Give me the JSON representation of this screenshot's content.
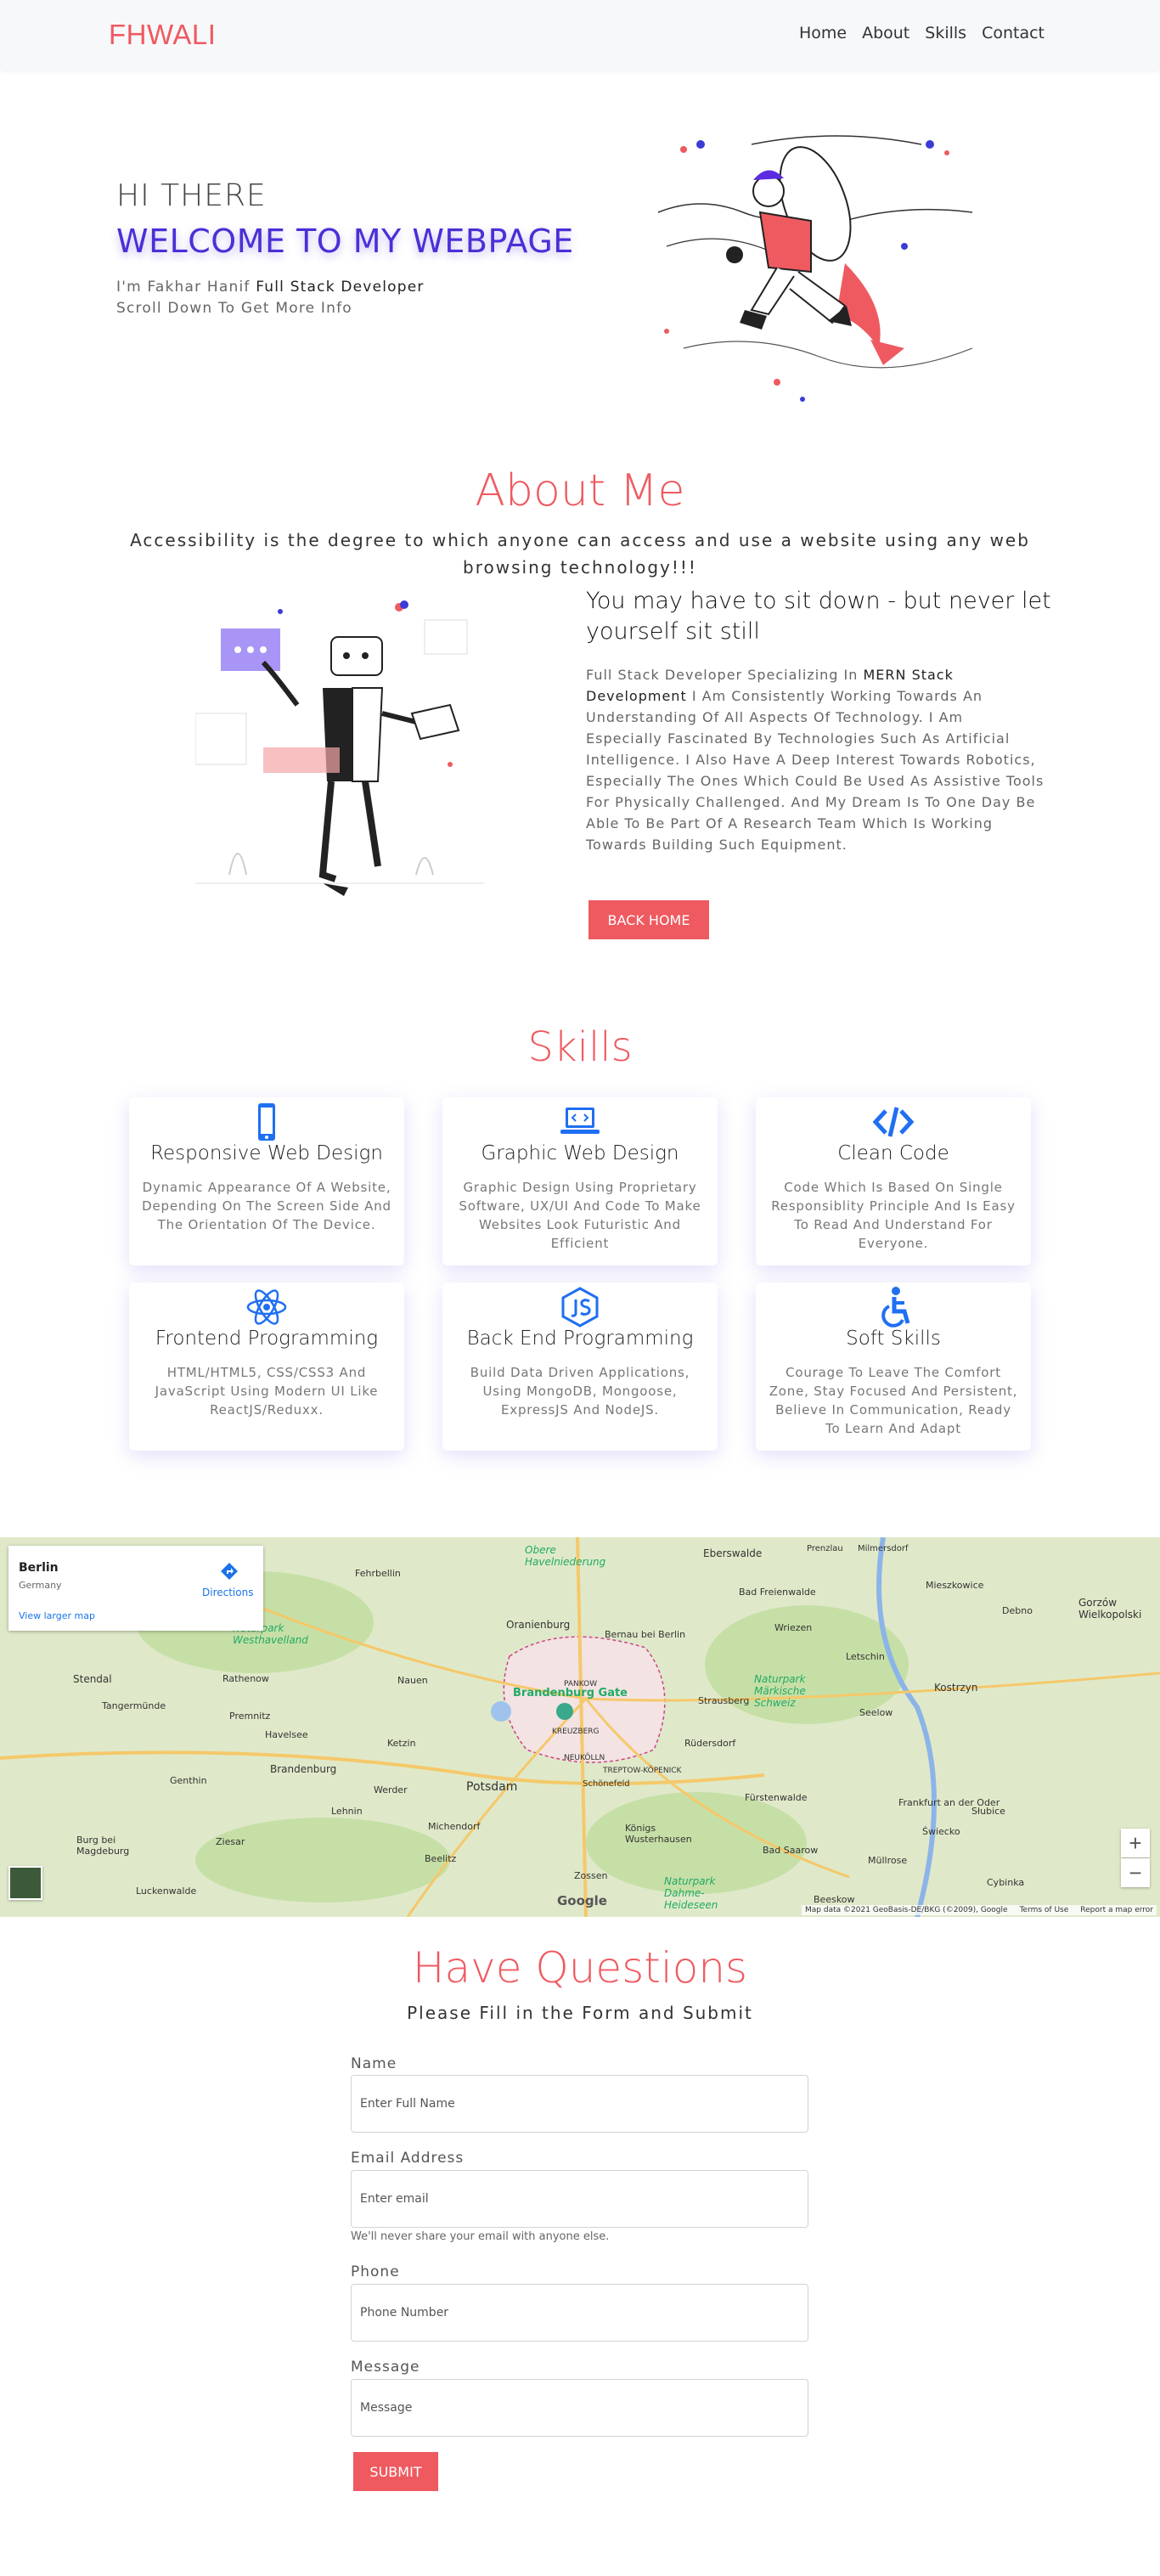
{
  "nav": {
    "brand": "FHWALI",
    "links": [
      "Home",
      "About",
      "Skills",
      "Contact"
    ]
  },
  "hero": {
    "greeting": "HI THERE",
    "welcome": "WELCOME TO MY WEBPAGE",
    "intro_prefix": "I'm Fakhar Hanif",
    "intro_role": "Full Stack Developer",
    "scroll_hint": "Scroll Down To Get More Info"
  },
  "about": {
    "title": "About Me",
    "subtitle": "Accessibility is the degree to which anyone can access and use a website using any web browsing technology!!!",
    "quote": "You may have to sit down - but never let yourself sit still",
    "body_prefix": "Full Stack Developer Specializing In",
    "body_highlight": "MERN Stack Development",
    "body_rest": "I Am Consistently Working Towards An Understanding Of All Aspects Of Technology. I Am Especially Fascinated By Technologies Such As Artificial Intelligence. I Also Have A Deep Interest Towards Robotics, Especially The Ones Which Could Be Used As Assistive Tools For Physically Challenged. And My Dream Is To One Day Be Able To Be Part Of A Research Team Which Is Working Towards Building Such Equipment.",
    "button": "BACK HOME"
  },
  "skills": {
    "title": "Skills",
    "items": [
      {
        "title": "Responsive Web Design",
        "desc": "Dynamic Appearance Of A Website, Depending On The Screen Side And The Orientation Of The Device.",
        "icon": "mobile-icon"
      },
      {
        "title": "Graphic Web Design",
        "desc": "Graphic Design Using Proprietary Software, UX/UI And Code To Make Websites Look Futuristic And Efficient",
        "icon": "laptop-code-icon"
      },
      {
        "title": "Clean Code",
        "desc": "Code Which Is Based On Single Responsiblity Principle And Is Easy To Read And Understand For Everyone.",
        "icon": "code-icon"
      },
      {
        "title": "Frontend Programming",
        "desc": "HTML/HTML5, CSS/CSS3 And JavaScript Using Modern UI Like ReactJS/Reduxx.",
        "icon": "react-icon"
      },
      {
        "title": "Back End Programming",
        "desc": "Build Data Driven Applications, Using MongoDB, Mongoose, ExpressJS And NodeJS.",
        "icon": "nodejs-icon"
      },
      {
        "title": "Soft Skills",
        "desc": "Courage To Leave The Comfort Zone, Stay Focused And Persistent, Believe In Communication, Ready To Learn And Adapt",
        "icon": "accessibility-icon"
      }
    ]
  },
  "map": {
    "city": "Berlin",
    "country": "Germany",
    "directions": "Directions",
    "larger": "View larger map",
    "google": "Google",
    "footer": [
      "Map data ©2021 GeoBasis-DE/BKG (©2009), Google",
      "Terms of Use",
      "Report a map error"
    ],
    "zoom_in": "+",
    "zoom_out": "−",
    "labels": [
      "Oranienburg",
      "Eberswalde",
      "Bernau bei Berlin",
      "Brandenburg Gate",
      "PANKOW",
      "KREUZBERG",
      "NEUKÖLLN",
      "TREPTOW-KÖPENICK",
      "Potsdam",
      "Werder",
      "Strausberg",
      "Frankfurt an der Oder",
      "Kostrzyn",
      "Beelitz",
      "Brandenburg",
      "Stendal",
      "Naturpark Westhavelland",
      "Naturpark Märkische Schweiz",
      "Fürstenwalde",
      "Schönefeld",
      "Zossen",
      "Naturpark Dahme-Heideseen",
      "Fehrbellin",
      "Obere Havelniederung",
      "Bad Freienwalde",
      "Seelow",
      "Rathenow",
      "Nauen",
      "Ketzin",
      "Rüdersdorf",
      "Luckenwalde",
      "Genthin",
      "Burg bei Magdeburg",
      "Ziesar",
      "Michendorf",
      "Königs Wusterhausen",
      "Bad Saarow",
      "Beeskow",
      "Müllrose",
      "Słubice",
      "Świecko",
      "Cybinka",
      "Gorzów Wielkopolski",
      "Debno",
      "Mieszkowice",
      "Wriezen",
      "Letschin",
      "Prenzlau",
      "Milmersdorf",
      "Tangermünde",
      "Havelsee",
      "Premnitz",
      "Lehnin"
    ]
  },
  "contact": {
    "title": "Have Questions",
    "subtitle": "Please Fill in the Form and Submit",
    "name_label": "Name",
    "name_placeholder": "Enter Full Name",
    "email_label": "Email Address",
    "email_placeholder": "Enter email",
    "email_help": "We'll never share your email with anyone else.",
    "phone_label": "Phone",
    "phone_placeholder": "Phone Number",
    "message_label": "Message",
    "message_placeholder": "Message",
    "submit": "SUBMIT"
  },
  "colors": {
    "accent": "#ee5a60",
    "purple": "#4b2fd6",
    "icon_blue": "#1f6ff2"
  }
}
